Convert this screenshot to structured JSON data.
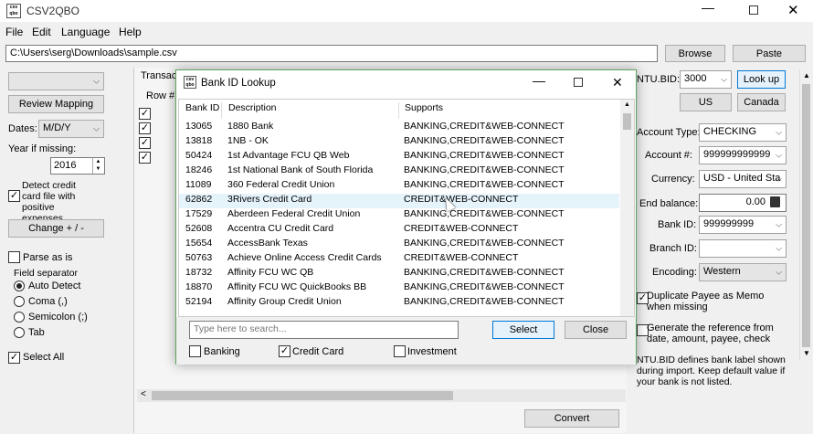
{
  "window": {
    "title": "CSV2QBO"
  },
  "menu": [
    "File",
    "Edit",
    "Language",
    "Help"
  ],
  "path": {
    "value": "C:\\Users\\serg\\Downloads\\sample.csv"
  },
  "top_buttons": {
    "browse": "Browse",
    "paste": "Paste"
  },
  "left": {
    "review_mapping": "Review Mapping",
    "dates_label": "Dates:",
    "dates_value": "M/D/Y",
    "year_label": "Year if missing:",
    "year_value": "2016",
    "detect_label": "Detect credit card file with positive expenses",
    "change_button": "Change + / -",
    "parse_as_is": "Parse as is",
    "field_separator": "Field separator",
    "separators": [
      "Auto Detect",
      "Coma (,)",
      "Semicolon (;)",
      "Tab"
    ],
    "select_all": "Select All"
  },
  "center": {
    "tab": "Transact",
    "row_header": "Row #",
    "convert": "Convert"
  },
  "right": {
    "intu_label": "NTU.BID:",
    "intu_value": "3000",
    "lookup": "Look up",
    "us": "US",
    "canada": "Canada",
    "account_type_label": "Account Type:",
    "account_type_value": "CHECKING",
    "account_num_label": "Account #:",
    "account_num_value": "999999999999",
    "currency_label": "Currency:",
    "currency_value": "USD - United Sta",
    "end_balance_label": "End balance:",
    "end_balance_value": "0.00",
    "bank_id_label": "Bank ID:",
    "bank_id_value": "999999999",
    "branch_id_label": "Branch ID:",
    "branch_id_value": "",
    "encoding_label": "Encoding:",
    "encoding_value": "Western",
    "dup_payee": "Duplicate Payee as Memo when missing",
    "gen_ref": "Generate the reference from date, amount, payee, check",
    "note": "NTU.BID defines bank label shown during import. Keep default value if your bank is not listed."
  },
  "dialog": {
    "title": "Bank ID Lookup",
    "columns": [
      "Bank ID",
      "Description",
      "Supports"
    ],
    "rows": [
      [
        "13065",
        "1880 Bank",
        "BANKING,CREDIT&WEB-CONNECT"
      ],
      [
        "13818",
        "1NB - OK",
        "BANKING,CREDIT&WEB-CONNECT"
      ],
      [
        "50424",
        "1st Advantage FCU QB Web",
        "BANKING,CREDIT&WEB-CONNECT"
      ],
      [
        "18246",
        "1st National Bank of South Florida",
        "BANKING,CREDIT&WEB-CONNECT"
      ],
      [
        "11089",
        "360 Federal Credit Union",
        "BANKING,CREDIT&WEB-CONNECT"
      ],
      [
        "62862",
        "3Rivers Credit Card",
        "CREDIT&WEB-CONNECT"
      ],
      [
        "17529",
        "Aberdeen Federal Credit Union",
        "BANKING,CREDIT&WEB-CONNECT"
      ],
      [
        "52608",
        "Accentra CU Credit Card",
        "CREDIT&WEB-CONNECT"
      ],
      [
        "15654",
        "AccessBank Texas",
        "BANKING,CREDIT&WEB-CONNECT"
      ],
      [
        "50763",
        "Achieve Online Access Credit Cards",
        "CREDIT&WEB-CONNECT"
      ],
      [
        "18732",
        "Affinity FCU WC QB",
        "BANKING,CREDIT&WEB-CONNECT"
      ],
      [
        "18870",
        "Affinity FCU WC QuickBooks BB",
        "BANKING,CREDIT&WEB-CONNECT"
      ],
      [
        "52194",
        "Affinity Group Credit Union",
        "BANKING,CREDIT&WEB-CONNECT"
      ]
    ],
    "search_placeholder": "Type here to search...",
    "select": "Select",
    "close": "Close",
    "filters": [
      {
        "label": "Banking",
        "checked": false
      },
      {
        "label": "Credit Card",
        "checked": true
      },
      {
        "label": "Investment",
        "checked": false
      }
    ]
  },
  "colors": {
    "accent": "#0078d7",
    "dialog_border": "#5ea45e",
    "selected_row": "#e5f3fb"
  }
}
